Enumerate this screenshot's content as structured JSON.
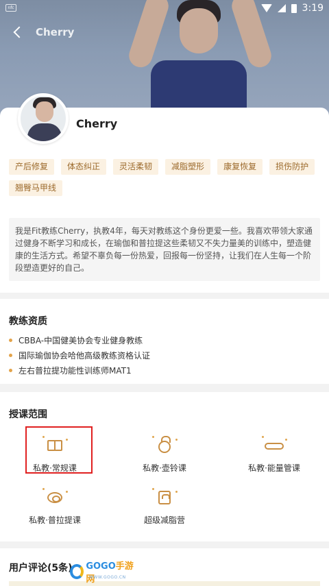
{
  "status_bar": {
    "time": "3:19"
  },
  "nav": {
    "title": "Cherry"
  },
  "coach": {
    "name": "Cherry",
    "tags": [
      "产后修复",
      "体态纠正",
      "灵活柔韧",
      "减脂塑形",
      "康复恢复",
      "损伤防护",
      "翘臀马甲线"
    ],
    "bio": "我是Fit教练Cherry，执教4年，每天对教练这个身份更爱一些。我喜欢带领大家通过健身不断学习和成长，在瑜伽和普拉提这些柔韧又不失力量美的训练中，塑造健康的生活方式。希望不辜负每一份热爱，回报每一份坚持，让我们在人生每一个阶段塑造更好的自己。"
  },
  "qualifications": {
    "title": "教练资质",
    "items": [
      "CBBA-中国健美协会专业健身教练",
      "国际瑜伽协会哈他高级教练资格认证",
      "左右普拉提功能性训练师MAT1"
    ]
  },
  "courses": {
    "title": "授课范围",
    "items": [
      {
        "label": "私教·常规课",
        "icon": "book-icon"
      },
      {
        "label": "私教·壶铃课",
        "icon": "kettlebell-icon"
      },
      {
        "label": "私教·能量管课",
        "icon": "energy-tube-icon"
      },
      {
        "label": "私教·普拉提课",
        "icon": "pilates-roll-icon"
      },
      {
        "label": "超级减脂营",
        "icon": "scale-icon"
      }
    ]
  },
  "comments": {
    "title": "用户评论(5条)"
  },
  "watermark": {
    "brand_a": "GOGO",
    "brand_b": "手游网",
    "sub": "WWW.GOGO.CN"
  },
  "colors": {
    "accent": "#c98f44",
    "tag_bg": "#fbf1e2",
    "highlight_border": "#e02020"
  }
}
